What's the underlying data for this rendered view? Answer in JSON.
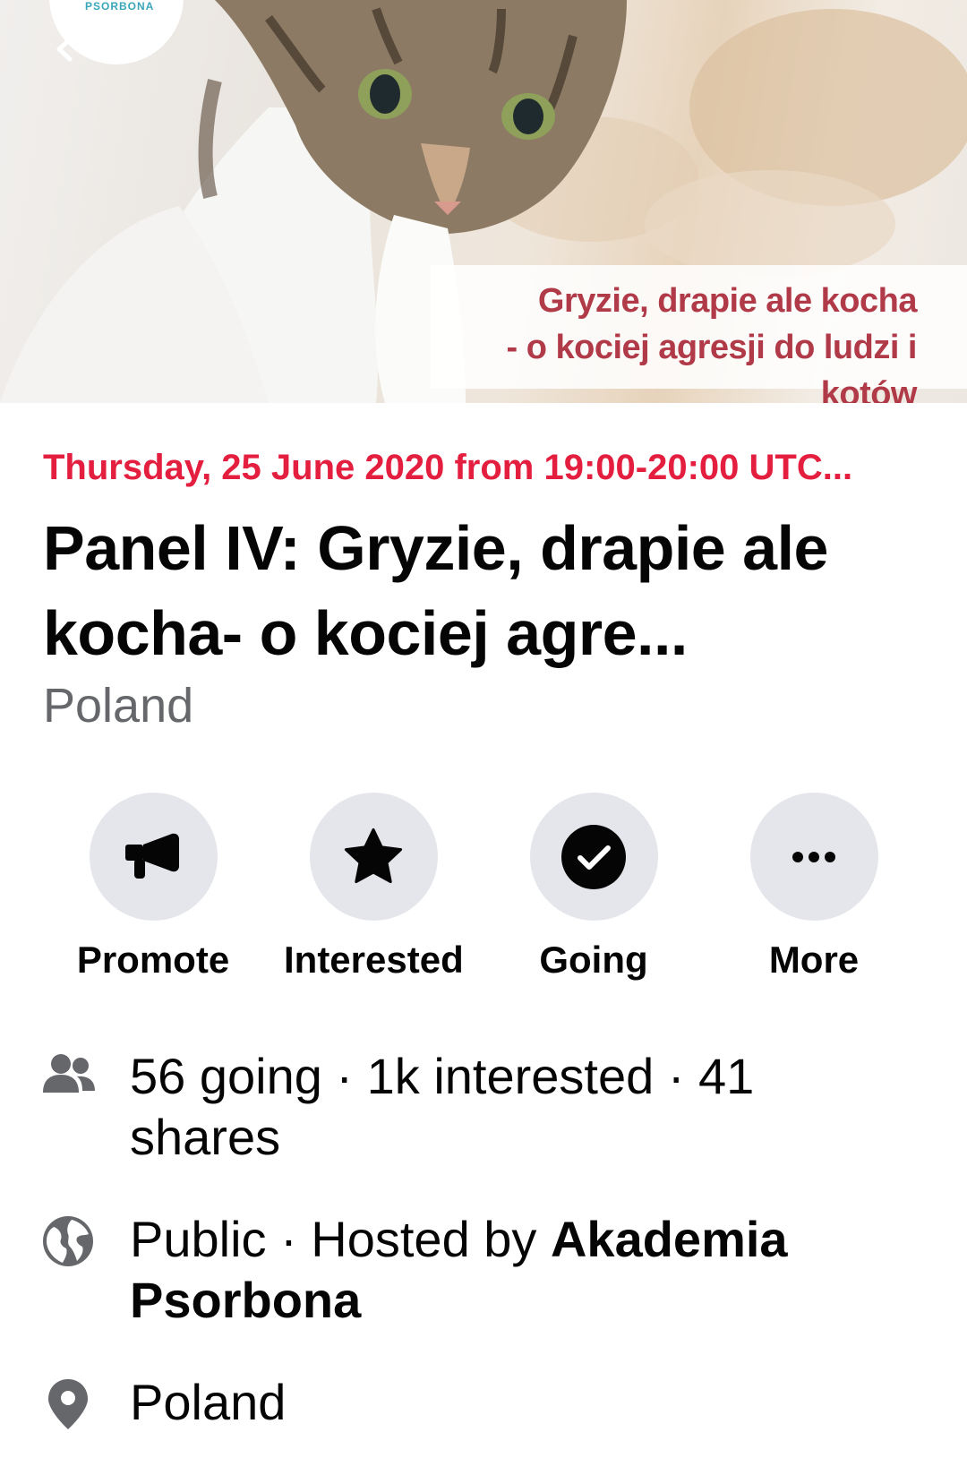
{
  "cover": {
    "logo_text": "PSORBONA",
    "caption_line1": "Gryzie, drapie ale kocha",
    "caption_line2": "- o kociej agresji do ludzi i kotów"
  },
  "event": {
    "date": "Thursday, 25 June 2020 from 19:00-20:00 UTC...",
    "title": "Panel IV: Gryzie, drapie ale kocha- o kociej agre...",
    "location": "Poland"
  },
  "actions": [
    {
      "label": "Promote",
      "icon": "megaphone-icon"
    },
    {
      "label": "Interested",
      "icon": "star-icon"
    },
    {
      "label": "Going",
      "icon": "check-circle-icon"
    },
    {
      "label": "More",
      "icon": "more-dots-icon"
    }
  ],
  "info": {
    "stats": "56 going · 1k interested · 41 shares",
    "privacy_prefix": "Public · Hosted by ",
    "host": "Akademia Psorbona",
    "place": "Poland"
  },
  "colors": {
    "date": "#e41e3f",
    "secondary_text": "#65676b",
    "action_circle": "#e4e6eb",
    "caption": "#b03a48"
  }
}
